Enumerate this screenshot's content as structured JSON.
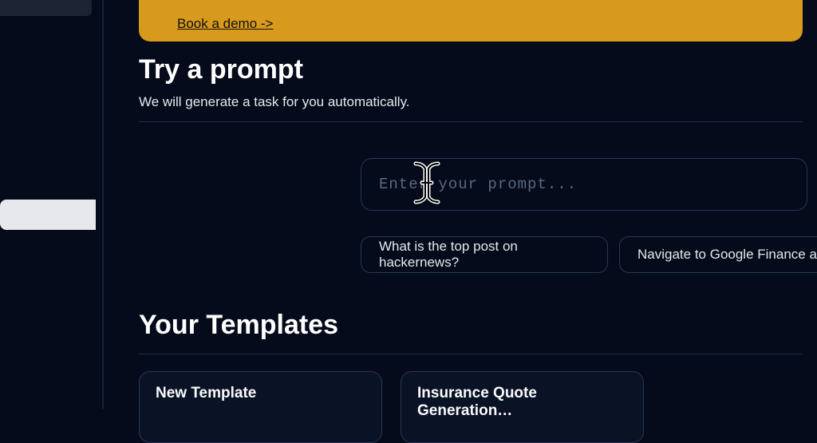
{
  "banner": {
    "link_label": "Book a demo ->"
  },
  "try_section": {
    "heading": "Try a prompt",
    "subtitle": "We will generate a task for you automatically.",
    "input_placeholder": "Enter your prompt...",
    "chips": [
      "What is the top post on hackernews?",
      "Navigate to Google Finance a"
    ]
  },
  "templates_section": {
    "heading": "Your Templates",
    "cards": [
      {
        "title": "New Template"
      },
      {
        "title": "Insurance Quote Generation…"
      }
    ]
  }
}
